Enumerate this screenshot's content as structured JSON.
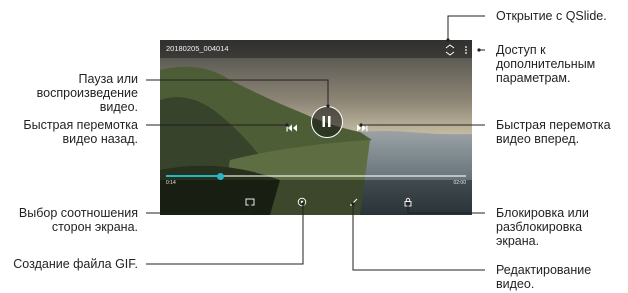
{
  "player": {
    "title": "20180205_004014",
    "elapsed": "0:14",
    "total": "02:00",
    "progress": 0.18
  },
  "labels": {
    "qslide": "Открытие с QSlide.",
    "more": "Доступ к\nдополнительным\nпараметрам.",
    "pause_play": "Пауза или\nвоспроизведение\nвидео.",
    "rewind": "Быстрая перемотка\nвидео назад.",
    "forward": "Быстрая перемотка\nвидео вперед.",
    "aspect": "Выбор соотношения\nсторон экрана.",
    "lock": "Блокировка или\nразблокировка\nэкрана.",
    "gif": "Создание файла GIF.",
    "edit": "Редактирование\nвидео."
  },
  "colors": {
    "progress_accent": "#28b4c8",
    "leader": "#231f20"
  },
  "icons": [
    "qslide-icon",
    "more-options-icon",
    "pause-icon",
    "rewind-icon",
    "fast-forward-icon",
    "aspect-ratio-icon",
    "gif-icon",
    "edit-icon",
    "lock-icon"
  ]
}
